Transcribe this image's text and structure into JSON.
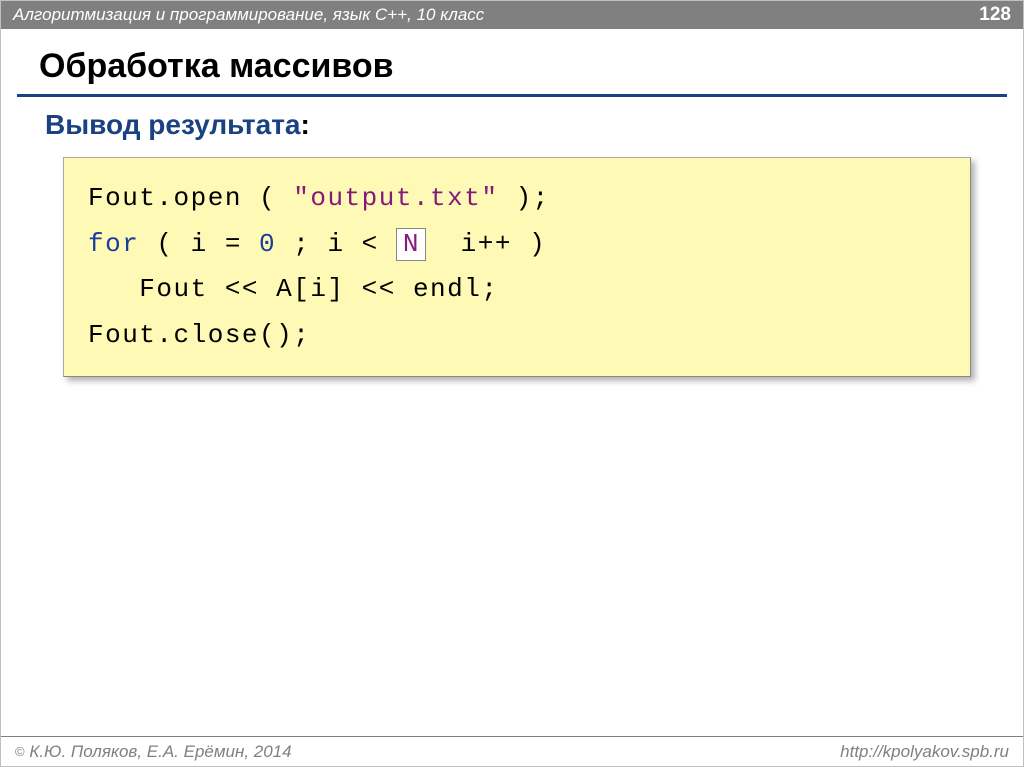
{
  "header": {
    "course_title": "Алгоритмизация и программирование, язык C++, 10 класс",
    "page_number": "128"
  },
  "title": "Обработка массивов",
  "subtitle": "Вывод результата",
  "code": {
    "line1": {
      "t1": "Fout.open ( ",
      "str": "\"output.txt\"",
      "t2": " );"
    },
    "line2": {
      "kw": "for",
      "t1": " ( i = ",
      "num": "0",
      "t2": " ; i < ",
      "boxed": "N",
      "t3": "  i++ )"
    },
    "line3": "   Fout << A[i] << endl;",
    "line4": "Fout.close();"
  },
  "footer": {
    "copyright": " К.Ю. Поляков, Е.А. Ерёмин, 2014",
    "url": "http://kpolyakov.spb.ru"
  }
}
